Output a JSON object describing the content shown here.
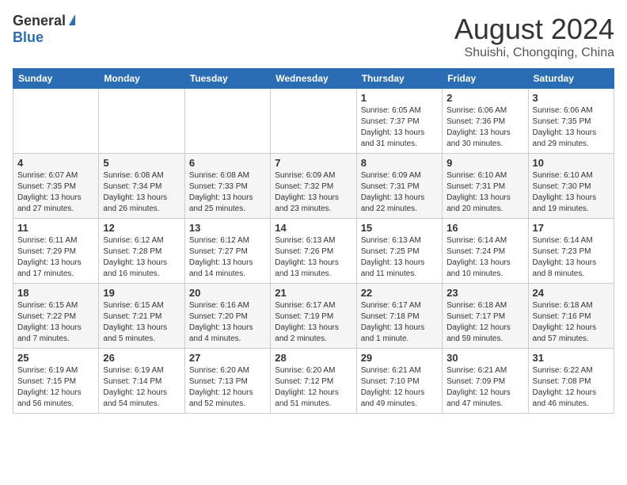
{
  "logo": {
    "general": "General",
    "blue": "Blue"
  },
  "title": {
    "month_year": "August 2024",
    "location": "Shuishi, Chongqing, China"
  },
  "days_of_week": [
    "Sunday",
    "Monday",
    "Tuesday",
    "Wednesday",
    "Thursday",
    "Friday",
    "Saturday"
  ],
  "weeks": [
    [
      {
        "day": "",
        "info": ""
      },
      {
        "day": "",
        "info": ""
      },
      {
        "day": "",
        "info": ""
      },
      {
        "day": "",
        "info": ""
      },
      {
        "day": "1",
        "info": "Sunrise: 6:05 AM\nSunset: 7:37 PM\nDaylight: 13 hours and 31 minutes."
      },
      {
        "day": "2",
        "info": "Sunrise: 6:06 AM\nSunset: 7:36 PM\nDaylight: 13 hours and 30 minutes."
      },
      {
        "day": "3",
        "info": "Sunrise: 6:06 AM\nSunset: 7:35 PM\nDaylight: 13 hours and 29 minutes."
      }
    ],
    [
      {
        "day": "4",
        "info": "Sunrise: 6:07 AM\nSunset: 7:35 PM\nDaylight: 13 hours and 27 minutes."
      },
      {
        "day": "5",
        "info": "Sunrise: 6:08 AM\nSunset: 7:34 PM\nDaylight: 13 hours and 26 minutes."
      },
      {
        "day": "6",
        "info": "Sunrise: 6:08 AM\nSunset: 7:33 PM\nDaylight: 13 hours and 25 minutes."
      },
      {
        "day": "7",
        "info": "Sunrise: 6:09 AM\nSunset: 7:32 PM\nDaylight: 13 hours and 23 minutes."
      },
      {
        "day": "8",
        "info": "Sunrise: 6:09 AM\nSunset: 7:31 PM\nDaylight: 13 hours and 22 minutes."
      },
      {
        "day": "9",
        "info": "Sunrise: 6:10 AM\nSunset: 7:31 PM\nDaylight: 13 hours and 20 minutes."
      },
      {
        "day": "10",
        "info": "Sunrise: 6:10 AM\nSunset: 7:30 PM\nDaylight: 13 hours and 19 minutes."
      }
    ],
    [
      {
        "day": "11",
        "info": "Sunrise: 6:11 AM\nSunset: 7:29 PM\nDaylight: 13 hours and 17 minutes."
      },
      {
        "day": "12",
        "info": "Sunrise: 6:12 AM\nSunset: 7:28 PM\nDaylight: 13 hours and 16 minutes."
      },
      {
        "day": "13",
        "info": "Sunrise: 6:12 AM\nSunset: 7:27 PM\nDaylight: 13 hours and 14 minutes."
      },
      {
        "day": "14",
        "info": "Sunrise: 6:13 AM\nSunset: 7:26 PM\nDaylight: 13 hours and 13 minutes."
      },
      {
        "day": "15",
        "info": "Sunrise: 6:13 AM\nSunset: 7:25 PM\nDaylight: 13 hours and 11 minutes."
      },
      {
        "day": "16",
        "info": "Sunrise: 6:14 AM\nSunset: 7:24 PM\nDaylight: 13 hours and 10 minutes."
      },
      {
        "day": "17",
        "info": "Sunrise: 6:14 AM\nSunset: 7:23 PM\nDaylight: 13 hours and 8 minutes."
      }
    ],
    [
      {
        "day": "18",
        "info": "Sunrise: 6:15 AM\nSunset: 7:22 PM\nDaylight: 13 hours and 7 minutes."
      },
      {
        "day": "19",
        "info": "Sunrise: 6:15 AM\nSunset: 7:21 PM\nDaylight: 13 hours and 5 minutes."
      },
      {
        "day": "20",
        "info": "Sunrise: 6:16 AM\nSunset: 7:20 PM\nDaylight: 13 hours and 4 minutes."
      },
      {
        "day": "21",
        "info": "Sunrise: 6:17 AM\nSunset: 7:19 PM\nDaylight: 13 hours and 2 minutes."
      },
      {
        "day": "22",
        "info": "Sunrise: 6:17 AM\nSunset: 7:18 PM\nDaylight: 13 hours and 1 minute."
      },
      {
        "day": "23",
        "info": "Sunrise: 6:18 AM\nSunset: 7:17 PM\nDaylight: 12 hours and 59 minutes."
      },
      {
        "day": "24",
        "info": "Sunrise: 6:18 AM\nSunset: 7:16 PM\nDaylight: 12 hours and 57 minutes."
      }
    ],
    [
      {
        "day": "25",
        "info": "Sunrise: 6:19 AM\nSunset: 7:15 PM\nDaylight: 12 hours and 56 minutes."
      },
      {
        "day": "26",
        "info": "Sunrise: 6:19 AM\nSunset: 7:14 PM\nDaylight: 12 hours and 54 minutes."
      },
      {
        "day": "27",
        "info": "Sunrise: 6:20 AM\nSunset: 7:13 PM\nDaylight: 12 hours and 52 minutes."
      },
      {
        "day": "28",
        "info": "Sunrise: 6:20 AM\nSunset: 7:12 PM\nDaylight: 12 hours and 51 minutes."
      },
      {
        "day": "29",
        "info": "Sunrise: 6:21 AM\nSunset: 7:10 PM\nDaylight: 12 hours and 49 minutes."
      },
      {
        "day": "30",
        "info": "Sunrise: 6:21 AM\nSunset: 7:09 PM\nDaylight: 12 hours and 47 minutes."
      },
      {
        "day": "31",
        "info": "Sunrise: 6:22 AM\nSunset: 7:08 PM\nDaylight: 12 hours and 46 minutes."
      }
    ]
  ]
}
